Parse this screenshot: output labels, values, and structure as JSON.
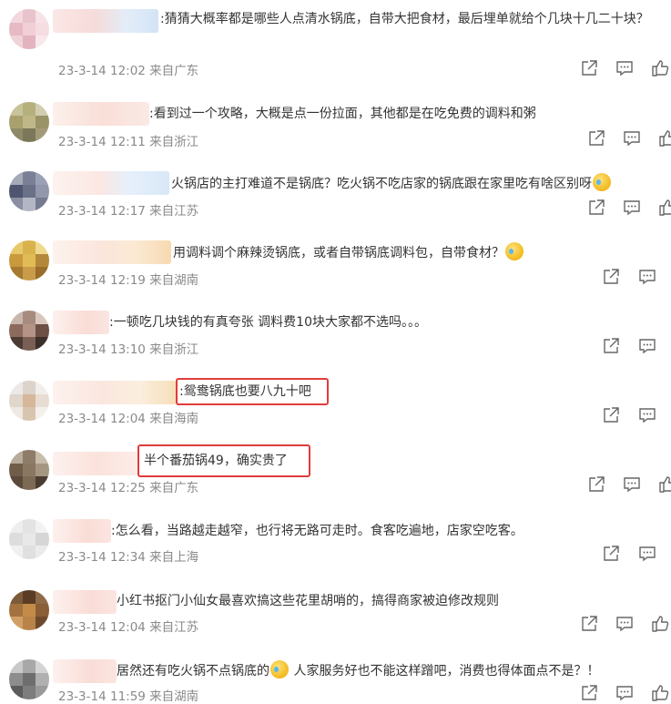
{
  "comments": [
    {
      "text": ":猜猜大概率都是哪些人点清水锅底，自带大把食材，最后埋单就给个几块十几二十块？",
      "meta": "23-3-14 12:02 来自广东",
      "actions": [
        "share-icon",
        "comment-icon",
        "like-icon"
      ]
    },
    {
      "text": ":看到过一个攻略，大概是点一份拉面，其他都是在吃免费的调料和粥",
      "meta": "23-3-14 12:11 来自浙江",
      "actions": [
        "share-icon",
        "comment-icon",
        "like-icon"
      ]
    },
    {
      "text": "火锅店的主打难道不是锅底？吃火锅不吃店家的锅底跟在家里吃有啥区别呀",
      "meta": "23-3-14 12:17 来自江苏",
      "actions": [
        "share-icon",
        "comment-icon",
        "like-icon"
      ]
    },
    {
      "text": "用调料调个麻辣烫锅底，或者自带锅底调料包，自带食材？",
      "meta": "23-3-14 12:19 来自湖南",
      "actions": [
        "share-icon",
        "comment-icon"
      ]
    },
    {
      "text": ":一顿吃几块钱的有真夸张  调料费10块大家都不选吗。。。",
      "meta": "23-3-14 13:10 来自浙江",
      "actions": [
        "share-icon",
        "comment-icon"
      ]
    },
    {
      "text": ":鸳鸯锅底也要八九十吧",
      "meta": "23-3-14 12:04 来自海南",
      "actions": [
        "share-icon",
        "comment-icon"
      ]
    },
    {
      "text": "半个番茄锅49，确实贵了",
      "meta": "23-3-14 12:25 来自广东",
      "actions": [
        "share-icon",
        "comment-icon",
        "like-icon"
      ]
    },
    {
      "text": ":怎么看，当路越走越窄，也行将无路可走时。食客吃遍地，店家空吃客。",
      "meta": "23-3-14 12:34 来自上海",
      "actions": [
        "share-icon",
        "comment-icon"
      ]
    },
    {
      "text": "小红书抠门小仙女最喜欢搞这些花里胡哨的，搞得商家被迫修改规则",
      "meta": "23-3-14 12:04 来自江苏",
      "actions": [
        "share-icon",
        "comment-icon",
        "like-icon"
      ]
    },
    {
      "text_before": "居然还有吃火锅不点锅底的",
      "text_after": " 人家服务好也不能这样蹭吧，消费也得体面点不是？！",
      "meta": "23-3-14 11:59 来自湖南",
      "actions": [
        "share-icon",
        "comment-icon",
        "like-icon"
      ]
    }
  ]
}
